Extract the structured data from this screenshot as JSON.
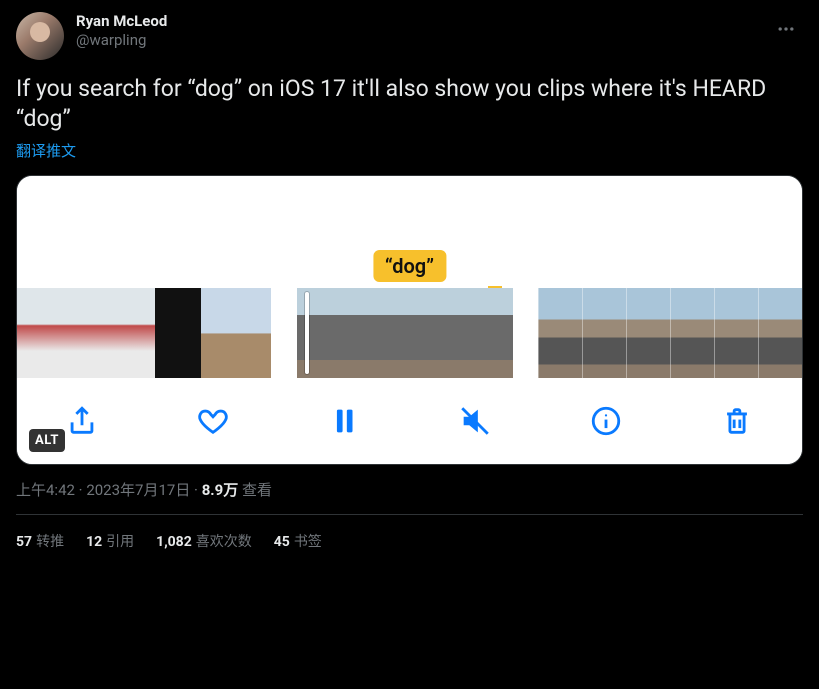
{
  "tweet": {
    "author": {
      "display_name": "Ryan McLeod",
      "username": "@warpling"
    },
    "text": "If you search for “dog” on iOS 17 it'll also show you clips where it's HEARD “dog”",
    "translate_label": "翻译推文",
    "dog_tag": "“dog”",
    "alt_badge": "ALT",
    "timestamp": "上午4:42",
    "date": "2023年7月17日",
    "separator": " · ",
    "views_count": "8.9万",
    "views_label": " 查看"
  },
  "stats": {
    "retweets": {
      "count": "57",
      "label": "转推"
    },
    "quotes": {
      "count": "12",
      "label": "引用"
    },
    "likes": {
      "count": "1,082",
      "label": "喜欢次数"
    },
    "bookmarks": {
      "count": "45",
      "label": "书签"
    }
  },
  "icons": {
    "more": "more-icon",
    "share": "share-icon",
    "heart": "heart-icon",
    "pause": "pause-icon",
    "mute": "speaker-muted-icon",
    "info": "info-icon",
    "trash": "trash-icon"
  }
}
